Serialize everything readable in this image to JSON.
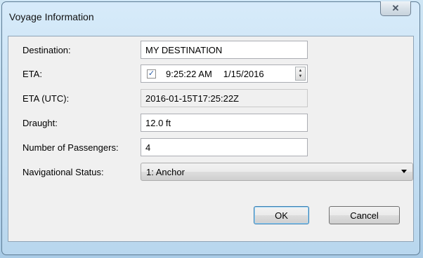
{
  "window": {
    "title": "Voyage Information",
    "close_glyph": "☒",
    "close_icon": "close-icon"
  },
  "form": {
    "destination_label": "Destination:",
    "destination_value": "MY DESTINATION",
    "eta_label": "ETA:",
    "eta_checked": true,
    "eta_time": "9:25:22 AM",
    "eta_date": "1/15/2016",
    "eta_utc_label": "ETA (UTC):",
    "eta_utc_value": "2016-01-15T17:25:22Z",
    "draught_label": "Draught:",
    "draught_value": "12.0 ft",
    "passengers_label": "Number of Passengers:",
    "passengers_value": "4",
    "nav_status_label": "Navigational Status:",
    "nav_status_value": "1: Anchor"
  },
  "buttons": {
    "ok": "OK",
    "cancel": "Cancel"
  },
  "colors": {
    "window_frame": "#bcd9ee",
    "client": "#f0f0f0",
    "default_button_border": "#3c7fb1"
  }
}
